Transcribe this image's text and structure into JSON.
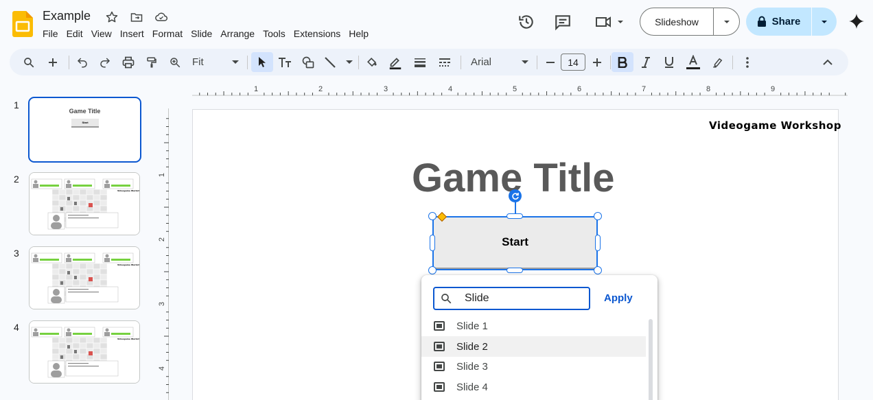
{
  "app": {
    "doc_title": "Example",
    "menu": [
      "File",
      "Edit",
      "View",
      "Insert",
      "Format",
      "Slide",
      "Arrange",
      "Tools",
      "Extensions",
      "Help"
    ],
    "slideshow_label": "Slideshow",
    "share_label": "Share",
    "colors": {
      "accent": "#0b57d0",
      "share_bg": "#c2e7ff",
      "toolbar_bg": "#edf2fa",
      "logo": "#fbbc04"
    }
  },
  "toolbar": {
    "zoom_value": "Fit",
    "font_name": "Arial",
    "font_size": "14"
  },
  "ruler": {
    "h_numbers": [
      "1",
      "2",
      "3",
      "4",
      "5",
      "6",
      "7",
      "8",
      "9"
    ],
    "v_numbers": [
      "1",
      "2",
      "3",
      "4"
    ]
  },
  "filmstrip": {
    "slides": [
      {
        "number": "1",
        "title": "Game Title",
        "button": "Start"
      },
      {
        "number": "2"
      },
      {
        "number": "3"
      },
      {
        "number": "4"
      }
    ]
  },
  "slide": {
    "workshop_label": "Videogame Workshop",
    "title": "Game Title",
    "start_label": "Start"
  },
  "link_popup": {
    "search_value": "Slide",
    "apply_label": "Apply",
    "items": [
      "Slide 1",
      "Slide 2",
      "Slide 3",
      "Slide 4"
    ],
    "highlighted": "Slide 2"
  }
}
